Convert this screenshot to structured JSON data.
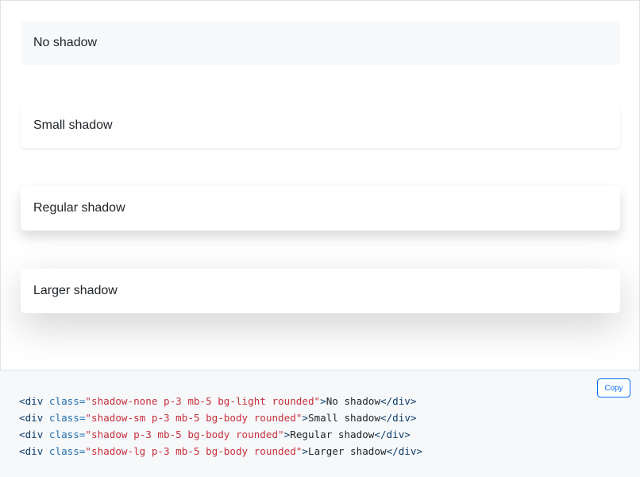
{
  "examples": [
    {
      "label": "No shadow"
    },
    {
      "label": "Small shadow"
    },
    {
      "label": "Regular shadow"
    },
    {
      "label": "Larger shadow"
    }
  ],
  "code": {
    "copy_label": "Copy",
    "lines": [
      {
        "open": "<div",
        "attr": " class=",
        "value": "\"shadow-none p-3 mb-5 bg-light rounded\"",
        "gt": ">",
        "text": "No shadow",
        "close": "</div>"
      },
      {
        "open": "<div",
        "attr": " class=",
        "value": "\"shadow-sm p-3 mb-5 bg-body rounded\"",
        "gt": ">",
        "text": "Small shadow",
        "close": "</div>"
      },
      {
        "open": "<div",
        "attr": " class=",
        "value": "\"shadow p-3 mb-5 bg-body rounded\"",
        "gt": ">",
        "text": "Regular shadow",
        "close": "</div>"
      },
      {
        "open": "<div",
        "attr": " class=",
        "value": "\"shadow-lg p-3 mb-5 bg-body rounded\"",
        "gt": ">",
        "text": "Larger shadow",
        "close": "</div>"
      }
    ]
  }
}
